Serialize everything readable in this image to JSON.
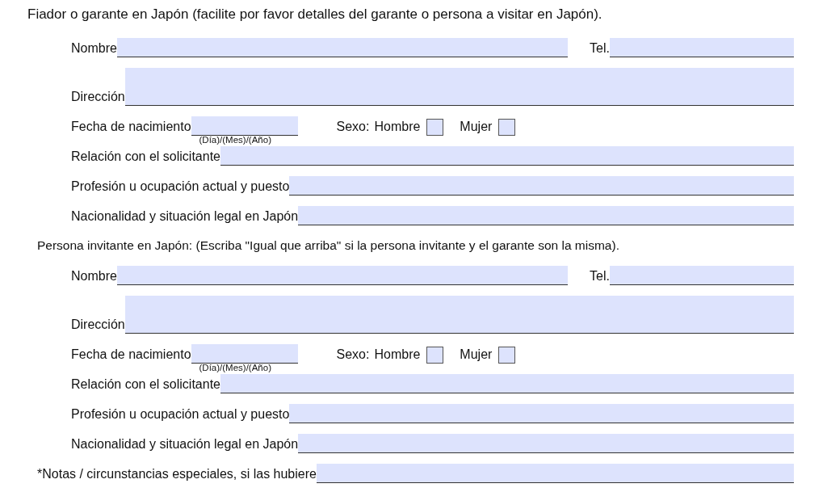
{
  "sections": [
    {
      "heading": "Fiador o garante en Japón (facilite por favor detalles del garante o persona a visitar en Japón).",
      "rows": [
        {
          "kind": "pair",
          "label": "Nombre",
          "second_label": "Tel."
        },
        {
          "kind": "tall",
          "label": "Dirección"
        },
        {
          "kind": "date",
          "label": "Fecha de nacimiento",
          "hint": "(Día)/(Mes)/(Año)",
          "sex_label": "Sexo:",
          "options": [
            {
              "label": "Hombre",
              "checked": false
            },
            {
              "label": "Mujer",
              "checked": false
            }
          ]
        },
        {
          "kind": "line",
          "label": "Relación con el solicitante"
        },
        {
          "kind": "line",
          "label": "Profesión u ocupación actual y puesto"
        },
        {
          "kind": "line",
          "label": "Nacionalidad y situación legal en Japón"
        }
      ]
    },
    {
      "heading": "Persona invitante en Japón: (Escriba \"Igual que arriba\" si la persona invitante y el garante son la misma).",
      "rows": [
        {
          "kind": "pair",
          "label": "Nombre",
          "second_label": "Tel."
        },
        {
          "kind": "tall",
          "label": "Dirección"
        },
        {
          "kind": "date",
          "label": "Fecha de nacimiento",
          "hint": "(Día)/(Mes)/(Año)",
          "sex_label": "Sexo:",
          "options": [
            {
              "label": "Hombre",
              "checked": false
            },
            {
              "label": "Mujer",
              "checked": false
            }
          ]
        },
        {
          "kind": "line",
          "label": "Relación con el solicitante"
        },
        {
          "kind": "line",
          "label": "Profesión u ocupación actual y puesto"
        },
        {
          "kind": "line",
          "label": "Nacionalidad y situación legal en Japón"
        }
      ]
    }
  ],
  "notes": {
    "label": "*Notas / circunstancias especiales, si las hubiere"
  }
}
